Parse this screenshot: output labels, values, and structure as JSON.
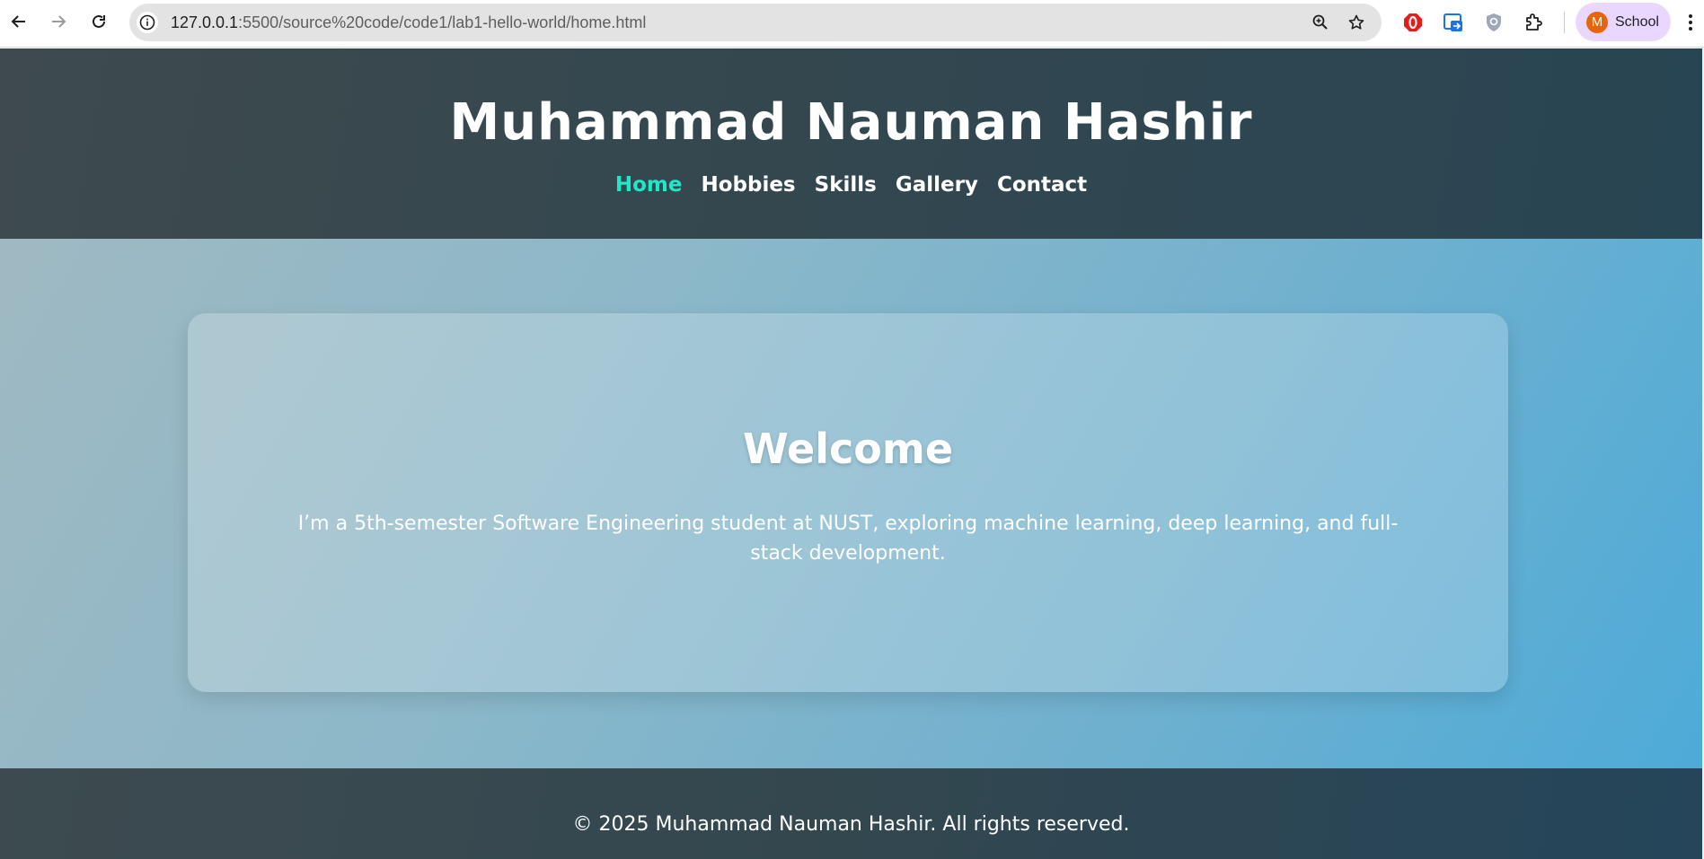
{
  "browser": {
    "url_host": "127.0.0.1",
    "url_rest": ":5500/source%20code/code1/lab1-hello-world/home.html",
    "profile_initial": "M",
    "profile_label": "School",
    "icons": {
      "back": "arrow-left-icon",
      "forward": "arrow-right-icon",
      "reload": "reload-icon",
      "site_info": "info-icon",
      "zoom": "zoom-icon",
      "bookmark": "star-icon",
      "menu": "kebab-menu-icon"
    },
    "extensions": [
      "opera-extension-icon",
      "translate-extension-icon",
      "shield-extension-icon",
      "puzzle-extensions-icon"
    ]
  },
  "site": {
    "title": "Muhammad Nauman Hashir",
    "nav": [
      {
        "label": "Home",
        "active": true
      },
      {
        "label": "Hobbies",
        "active": false
      },
      {
        "label": "Skills",
        "active": false
      },
      {
        "label": "Gallery",
        "active": false
      },
      {
        "label": "Contact",
        "active": false
      }
    ],
    "hero": {
      "heading": "Welcome",
      "text": "I’m a 5th-semester Software Engineering student at NUST, exploring machine learning, deep learning, and full-stack development."
    },
    "footer": "© 2025 Muhammad Nauman Hashir. All rights reserved."
  },
  "colors": {
    "nav_active": "#21e6c8",
    "header_bg": "#34474f",
    "hero_bg_start": "#9fb9c2",
    "hero_bg_end": "#4dabd8",
    "profile_bg": "#ead7ff",
    "avatar_bg": "#e8640a"
  }
}
